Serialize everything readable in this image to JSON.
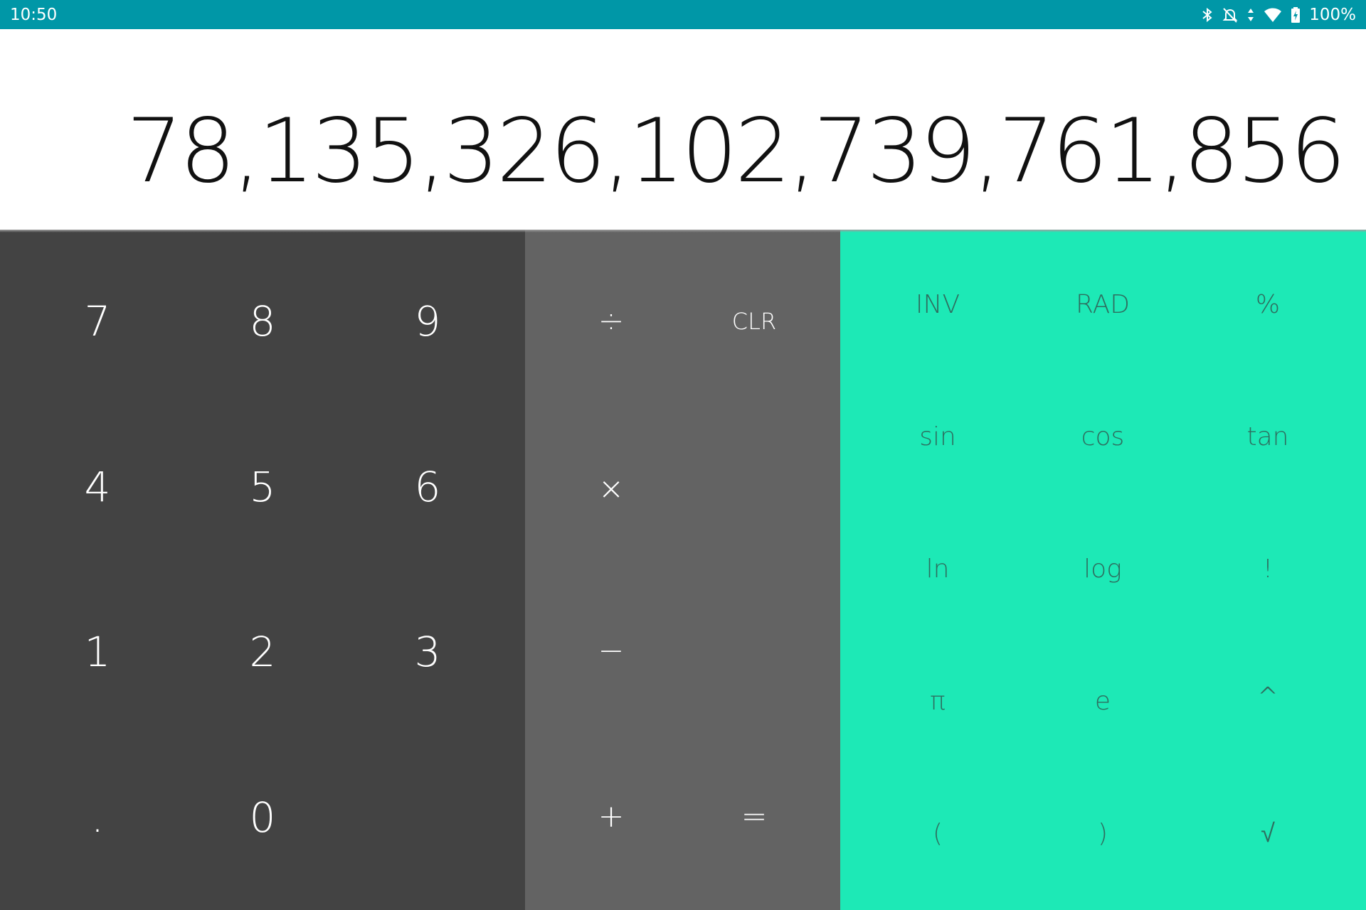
{
  "status_bar": {
    "time": "10:50",
    "icons": [
      "bluetooth-icon",
      "notifications-off-icon",
      "data-arrows-icon",
      "wifi-icon",
      "battery-charging-icon"
    ],
    "battery": "100%",
    "color": "#0097a7"
  },
  "display": {
    "value": "78,135,326,102,739,761,856"
  },
  "numpad": {
    "keys": [
      "7",
      "8",
      "9",
      "4",
      "5",
      "6",
      "1",
      "2",
      "3",
      ".",
      "0"
    ]
  },
  "operators": {
    "divide": "÷",
    "clear": "CLR",
    "multiply": "×",
    "minus": "−",
    "plus": "+",
    "equals": "="
  },
  "advanced": {
    "keys": [
      "INV",
      "RAD",
      "%",
      "sin",
      "cos",
      "tan",
      "ln",
      "log",
      "!",
      "π",
      "e",
      "^",
      "(",
      ")",
      "√"
    ]
  },
  "colors": {
    "numpad_bg": "#434343",
    "operators_bg": "#636363",
    "advanced_bg": "#1de9b6",
    "advanced_text": "#2e6e5f"
  }
}
